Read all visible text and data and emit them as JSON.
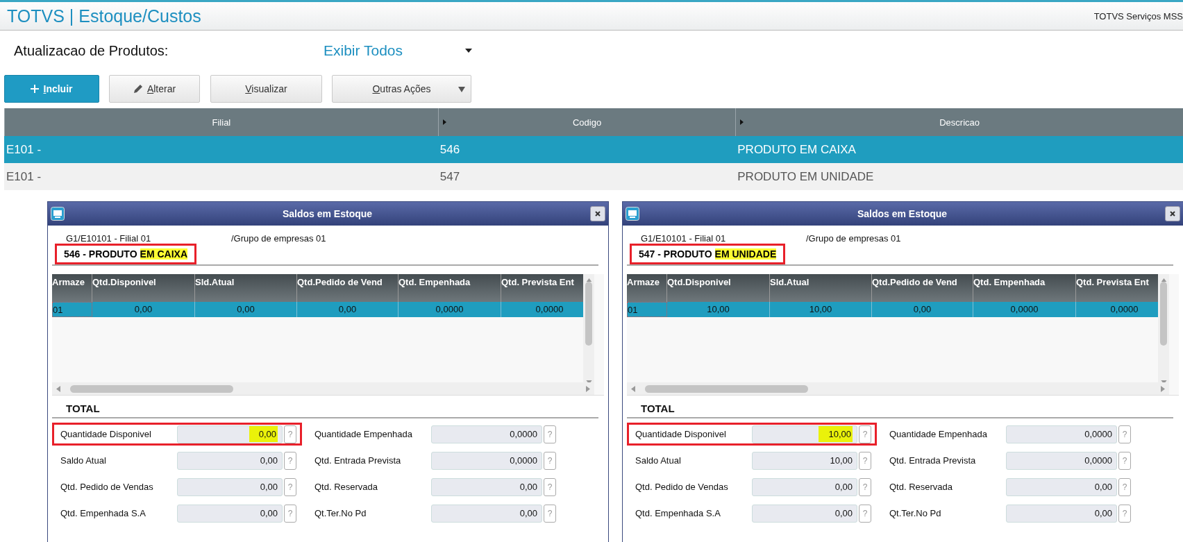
{
  "app_title": "TOTVS | Estoque/Custos",
  "company": "TOTVS Serviços MSS",
  "screen_label": "Atualizacao de Produtos:",
  "filter": {
    "value": "Exibir Todos"
  },
  "buttons": [
    {
      "label": "Incluir",
      "kind": "primary"
    },
    {
      "label": "Alterar",
      "kind": "edit"
    },
    {
      "label": "Visualizar",
      "kind": "plain"
    },
    {
      "label": "Outras Ações",
      "kind": "menu"
    }
  ],
  "table": {
    "columns": [
      "Filial",
      "Codigo",
      "Descricao"
    ],
    "rows": [
      {
        "cells": [
          "E101  -",
          "546",
          "PRODUTO EM CAIXA"
        ],
        "selected": true
      },
      {
        "cells": [
          "E101  -",
          "547",
          "PRODUTO EM UNIDADE"
        ],
        "selected": false
      }
    ]
  },
  "dialogs": [
    {
      "title": "Saldos em Estoque",
      "branch": "G1/E10101 - Filial 01",
      "group": "/Grupo de empresas 01",
      "product": {
        "text": "546 - PRODUTO",
        "highlight": "EM CAIXA",
        "framed": true
      },
      "grid": {
        "columns": [
          "Armaze",
          "Qtd.Disponivel",
          "Sld.Atual",
          "Qtd.Pedido de Vend",
          "Qtd. Empenhada",
          "Qtd. Prevista Ent"
        ],
        "rows": [
          {
            "cells": [
              "01",
              "0,00",
              "0,00",
              "0,00",
              "0,0000",
              "0,0000"
            ],
            "selected": true
          }
        ]
      },
      "total_label": "TOTAL",
      "fields_left": [
        {
          "label": "Quantidade Disponivel",
          "value": "0,00",
          "help": "?",
          "framed": true,
          "marked": true
        },
        {
          "label": "Saldo Atual",
          "value": "0,00",
          "help": "?",
          "framed": false,
          "marked": false
        },
        {
          "label": "Qtd. Pedido de Vendas",
          "value": "0,00",
          "help": "?",
          "framed": false,
          "marked": false
        },
        {
          "label": "Qtd. Empenhada S.A",
          "value": "0,00",
          "help": "?",
          "framed": false,
          "marked": false
        }
      ],
      "fields_right": [
        {
          "label": "Quantidade Empenhada",
          "value": "0,0000",
          "help": "?",
          "framed": false,
          "marked": false
        },
        {
          "label": "Qtd. Entrada Prevista",
          "value": "0,0000",
          "help": "?",
          "framed": false,
          "marked": false
        },
        {
          "label": "Qtd. Reservada",
          "value": "0,00",
          "help": "?",
          "framed": false,
          "marked": false
        },
        {
          "label": "Qt.Ter.No Pd",
          "value": "0,00",
          "help": "?",
          "framed": false,
          "marked": false
        }
      ]
    },
    {
      "title": "Saldos em Estoque",
      "branch": "G1/E10101 - Filial 01",
      "group": "/Grupo de empresas 01",
      "product": {
        "text": "547 - PRODUTO",
        "highlight": "EM UNIDADE",
        "framed": true
      },
      "grid": {
        "columns": [
          "Armaze",
          "Qtd.Disponivel",
          "Sld.Atual",
          "Qtd.Pedido de Vend",
          "Qtd. Empenhada",
          "Qtd. Prevista Ent"
        ],
        "rows": [
          {
            "cells": [
              "01",
              "10,00",
              "10,00",
              "0,00",
              "0,0000",
              "0,0000"
            ],
            "selected": true
          }
        ]
      },
      "total_label": "TOTAL",
      "fields_left": [
        {
          "label": "Quantidade Disponivel",
          "value": "10,00",
          "help": "?",
          "framed": true,
          "marked": true
        },
        {
          "label": "Saldo Atual",
          "value": "10,00",
          "help": "?",
          "framed": false,
          "marked": false
        },
        {
          "label": "Qtd. Pedido de Vendas",
          "value": "0,00",
          "help": "?",
          "framed": false,
          "marked": false
        },
        {
          "label": "Qtd. Empenhada S.A",
          "value": "0,00",
          "help": "?",
          "framed": false,
          "marked": false
        }
      ],
      "fields_right": [
        {
          "label": "Quantidade Empenhada",
          "value": "0,0000",
          "help": "?",
          "framed": false,
          "marked": false
        },
        {
          "label": "Qtd. Entrada Prevista",
          "value": "0,0000",
          "help": "?",
          "framed": false,
          "marked": false
        },
        {
          "label": "Qtd. Reservada",
          "value": "0,00",
          "help": "?",
          "framed": false,
          "marked": false
        },
        {
          "label": "Qt.Ter.No Pd",
          "value": "0,00",
          "help": "?",
          "framed": false,
          "marked": false
        }
      ]
    }
  ]
}
